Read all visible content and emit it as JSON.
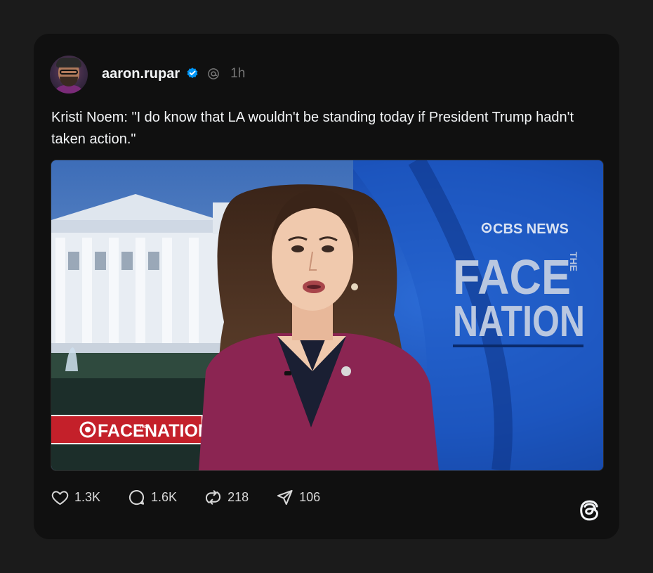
{
  "post": {
    "username": "aaron.rupar",
    "time": "1h",
    "text": "Kristi Noem: \"I do know that LA wouldn't be standing today if President Trump hadn't taken action.\""
  },
  "media": {
    "network_label": "CBS NEWS",
    "show_face": "FACE",
    "show_the": "THE",
    "show_nation": "NATION",
    "lower_third_face": "FACE",
    "lower_third_the": "THE",
    "lower_third_nation": "NATION"
  },
  "actions": {
    "likes": "1.3K",
    "replies": "1.6K",
    "reposts": "218",
    "shares": "106"
  },
  "icons": [
    "verified-badge-icon",
    "threads-mini-icon",
    "heart-icon",
    "comment-icon",
    "repost-icon",
    "share-icon",
    "threads-logo-icon"
  ],
  "colors": {
    "background": "#1b1b1b",
    "card": "#101010",
    "verified_blue": "#0095f6",
    "blazer": "#8b2552",
    "stage_blue": "#1a4fb5",
    "lower_third_red": "#c4202a"
  }
}
